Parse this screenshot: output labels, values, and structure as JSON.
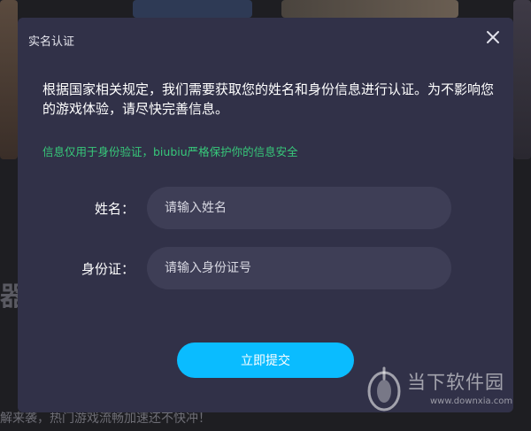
{
  "dialog": {
    "title": "实名认证",
    "close_icon": "close-icon",
    "notice": "根据国家相关规定，我们需要获取您的姓名和身份信息进行认证。为不影响您的游戏体验，请尽快完善信息。",
    "privacy_note": "信息仅用于身份验证，biubiu严格保护你的信息安全",
    "fields": {
      "name": {
        "label": "姓名：",
        "value": "",
        "placeholder": "请输入姓名"
      },
      "id_number": {
        "label": "身份证：",
        "value": "",
        "placeholder": "请输入身份证号"
      }
    },
    "submit_label": "立即提交"
  },
  "background": {
    "heading_fragment": "器工",
    "footer_text": "解来袭，热门游戏流畅加速还不快冲！"
  },
  "watermark": {
    "name": "当下软件园",
    "url": "www.downxia.com"
  },
  "colors": {
    "dialog_bg": "#313148",
    "input_bg": "#3e3e56",
    "accent_button": "#0abcff",
    "privacy_green": "#37c87a"
  }
}
